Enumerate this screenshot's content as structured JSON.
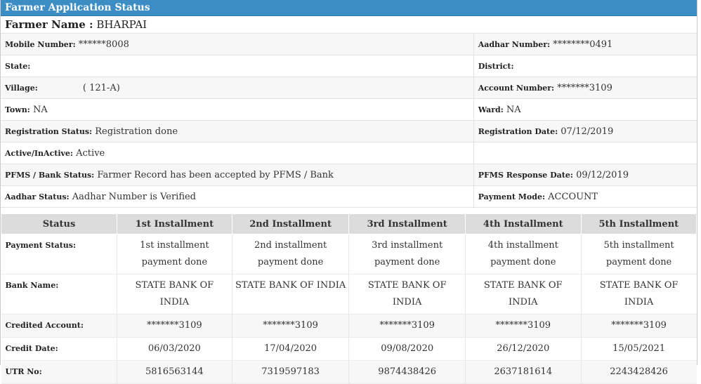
{
  "header": {
    "title": "Farmer Application Status"
  },
  "farmer": {
    "name_label": "Farmer Name :",
    "name": "BHARPAI"
  },
  "info": {
    "mobile_label": "Mobile Number:",
    "mobile": "******8008",
    "aadhar_label": "Aadhar Number:",
    "aadhar": "********0491",
    "state_label": "State:",
    "state": "",
    "district_label": "District:",
    "district": "",
    "village_label": "Village:",
    "village": "( 121-A)",
    "account_label": "Account Number:",
    "account": "*******3109",
    "town_label": "Town:",
    "town": "NA",
    "ward_label": "Ward:",
    "ward": "NA",
    "reg_status_label": "Registration Status:",
    "reg_status": "Registration done",
    "reg_date_label": "Registration Date:",
    "reg_date": "07/12/2019",
    "active_label": "Active/InActive:",
    "active": "Active",
    "pfms_status_label": "PFMS / Bank Status:",
    "pfms_status": "Farmer Record has been accepted by PFMS / Bank",
    "pfms_date_label": "PFMS Response Date:",
    "pfms_date": "09/12/2019",
    "aadhar_status_label": "Aadhar Status:",
    "aadhar_status": "Aadhar Number is Verified",
    "payment_mode_label": "Payment Mode:",
    "payment_mode": "ACCOUNT"
  },
  "installments": {
    "headers": [
      "Status",
      "1st Installment",
      "2nd Installment",
      "3rd Installment",
      "4th Installment",
      "5th Installment"
    ],
    "rows": [
      {
        "label": "Payment Status:",
        "values": [
          "1st installment payment done",
          "2nd installment payment done",
          "3rd installment payment done",
          "4th installment payment done",
          "5th installment payment done"
        ]
      },
      {
        "label": "Bank Name:",
        "values": [
          "STATE BANK OF INDIA",
          "STATE BANK OF INDIA",
          "STATE BANK OF INDIA",
          "STATE BANK OF INDIA",
          "STATE BANK OF INDIA"
        ]
      },
      {
        "label": "Credited Account:",
        "values": [
          "*******3109",
          "*******3109",
          "*******3109",
          "*******3109",
          "*******3109"
        ]
      },
      {
        "label": "Credit Date:",
        "values": [
          "06/03/2020",
          "17/04/2020",
          "09/08/2020",
          "26/12/2020",
          "15/05/2021"
        ]
      },
      {
        "label": "UTR No:",
        "values": [
          "5816563144",
          "7319597183",
          "9874438426",
          "2637181614",
          "2243428426"
        ]
      }
    ]
  }
}
